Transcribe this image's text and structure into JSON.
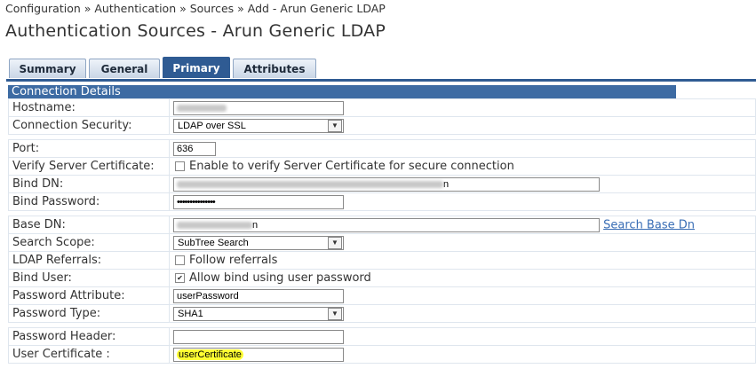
{
  "breadcrumb": "Configuration » Authentication » Sources » Add - Arun Generic LDAP",
  "page_title": "Authentication Sources - Arun Generic LDAP",
  "tabs": [
    {
      "label": "Summary",
      "active": false
    },
    {
      "label": "General",
      "active": false
    },
    {
      "label": "Primary",
      "active": true
    },
    {
      "label": "Attributes",
      "active": false
    }
  ],
  "section_header": "Connection Details",
  "fields": {
    "hostname": {
      "label": "Hostname:"
    },
    "connection_security": {
      "label": "Connection Security:",
      "value": "LDAP over SSL"
    },
    "port": {
      "label": "Port:",
      "value": "636"
    },
    "verify_cert": {
      "label": "Verify Server Certificate:",
      "checkbox_label": "Enable to verify Server Certificate for secure connection",
      "checked": false
    },
    "bind_dn": {
      "label": "Bind DN:",
      "visible_suffix": "n"
    },
    "bind_password": {
      "label": "Bind Password:",
      "value": "•••••••••••••••"
    },
    "base_dn": {
      "label": "Base DN:",
      "visible_suffix": "n",
      "link": "Search Base Dn"
    },
    "search_scope": {
      "label": "Search Scope:",
      "value": "SubTree Search"
    },
    "ldap_referrals": {
      "label": "LDAP Referrals:",
      "checkbox_label": "Follow referrals",
      "checked": false
    },
    "bind_user": {
      "label": "Bind User:",
      "checkbox_label": "Allow bind using user password",
      "checked": true
    },
    "password_attribute": {
      "label": "Password Attribute:",
      "value": "userPassword"
    },
    "password_type": {
      "label": "Password Type:",
      "value": "SHA1"
    },
    "password_header": {
      "label": "Password Header:",
      "value": ""
    },
    "user_certificate": {
      "label": "User Certificate :",
      "value": "userCertificate"
    }
  },
  "icons": {
    "select_arrow": "chevron-down-icon",
    "checkmark": "check-icon"
  },
  "colors": {
    "tab_active": "#2f5b93",
    "section_header": "#3d6ba3",
    "link": "#3b6fb6",
    "highlight": "#ffff33"
  }
}
